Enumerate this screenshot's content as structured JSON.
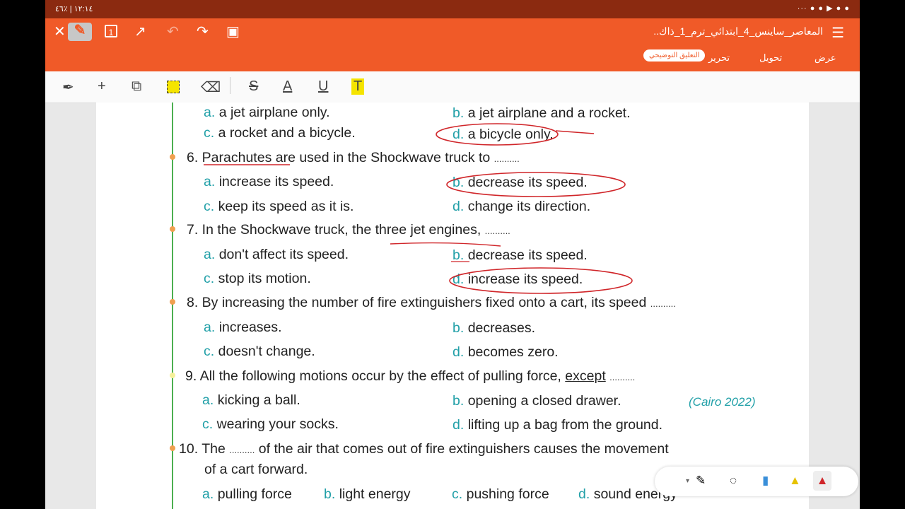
{
  "status": {
    "left": "١٢:١٤ | ٪٤٦",
    "right": "··· ● ● ▶ ● ●"
  },
  "header": {
    "title": "المعاصر_ساينس_4_ابتدائي_ترم_1_ذاك..",
    "page_indicator": "1",
    "tabs": [
      "التعليق التوضيحي",
      "تحرير",
      "تحويل",
      "عرض"
    ]
  },
  "q5": {
    "a": {
      "letter": "a.",
      "text": "a jet airplane only."
    },
    "b": {
      "letter": "b.",
      "text": "a jet airplane and a rocket."
    },
    "c": {
      "letter": "c.",
      "text": "a rocket and a bicycle."
    },
    "d": {
      "letter": "d.",
      "text": "a bicycle only."
    }
  },
  "q6": {
    "question": "6. Parachutes are used in the Shockwave truck to",
    "blank": "..........",
    "a": {
      "letter": "a.",
      "text": "increase its speed."
    },
    "b": {
      "letter": "b.",
      "text": "decrease its speed."
    },
    "c": {
      "letter": "c.",
      "text": "keep its speed as it is."
    },
    "d": {
      "letter": "d.",
      "text": "change its direction."
    }
  },
  "q7": {
    "question": "7. In the Shockwave truck, the three jet engines,",
    "blank": "..........",
    "a": {
      "letter": "a.",
      "text": "don't affect its speed."
    },
    "b": {
      "letter": "b.",
      "text": "decrease its speed."
    },
    "c": {
      "letter": "c.",
      "text": "stop its motion."
    },
    "d": {
      "letter": "d.",
      "text": "increase its speed."
    }
  },
  "q8": {
    "question": "8. By increasing the number of fire extinguishers fixed onto a cart, its speed",
    "blank": "..........",
    "a": {
      "letter": "a.",
      "text": "increases."
    },
    "b": {
      "letter": "b.",
      "text": "decreases."
    },
    "c": {
      "letter": "c.",
      "text": "doesn't change."
    },
    "d": {
      "letter": "d.",
      "text": "becomes zero."
    }
  },
  "q9": {
    "question": "9. All the following motions occur by the effect of pulling force,",
    "except": "except",
    "blank": "..........",
    "source": "(Cairo 2022)",
    "a": {
      "letter": "a.",
      "text": "kicking a ball."
    },
    "b": {
      "letter": "b.",
      "text": "opening a closed drawer."
    },
    "c": {
      "letter": "c.",
      "text": "wearing your socks."
    },
    "d": {
      "letter": "d.",
      "text": "lifting up a bag from the ground."
    }
  },
  "q10": {
    "number": "10.",
    "before": "The",
    "blank": "..........",
    "after": "of the air that comes out of fire extinguishers causes the movement",
    "line2": "of a cart forward.",
    "a": {
      "letter": "a.",
      "text": "pulling force"
    },
    "b": {
      "letter": "b.",
      "text": "light energy"
    },
    "c": {
      "letter": "c.",
      "text": "pushing force"
    },
    "d": {
      "letter": "d.",
      "text": "sound energy"
    }
  }
}
